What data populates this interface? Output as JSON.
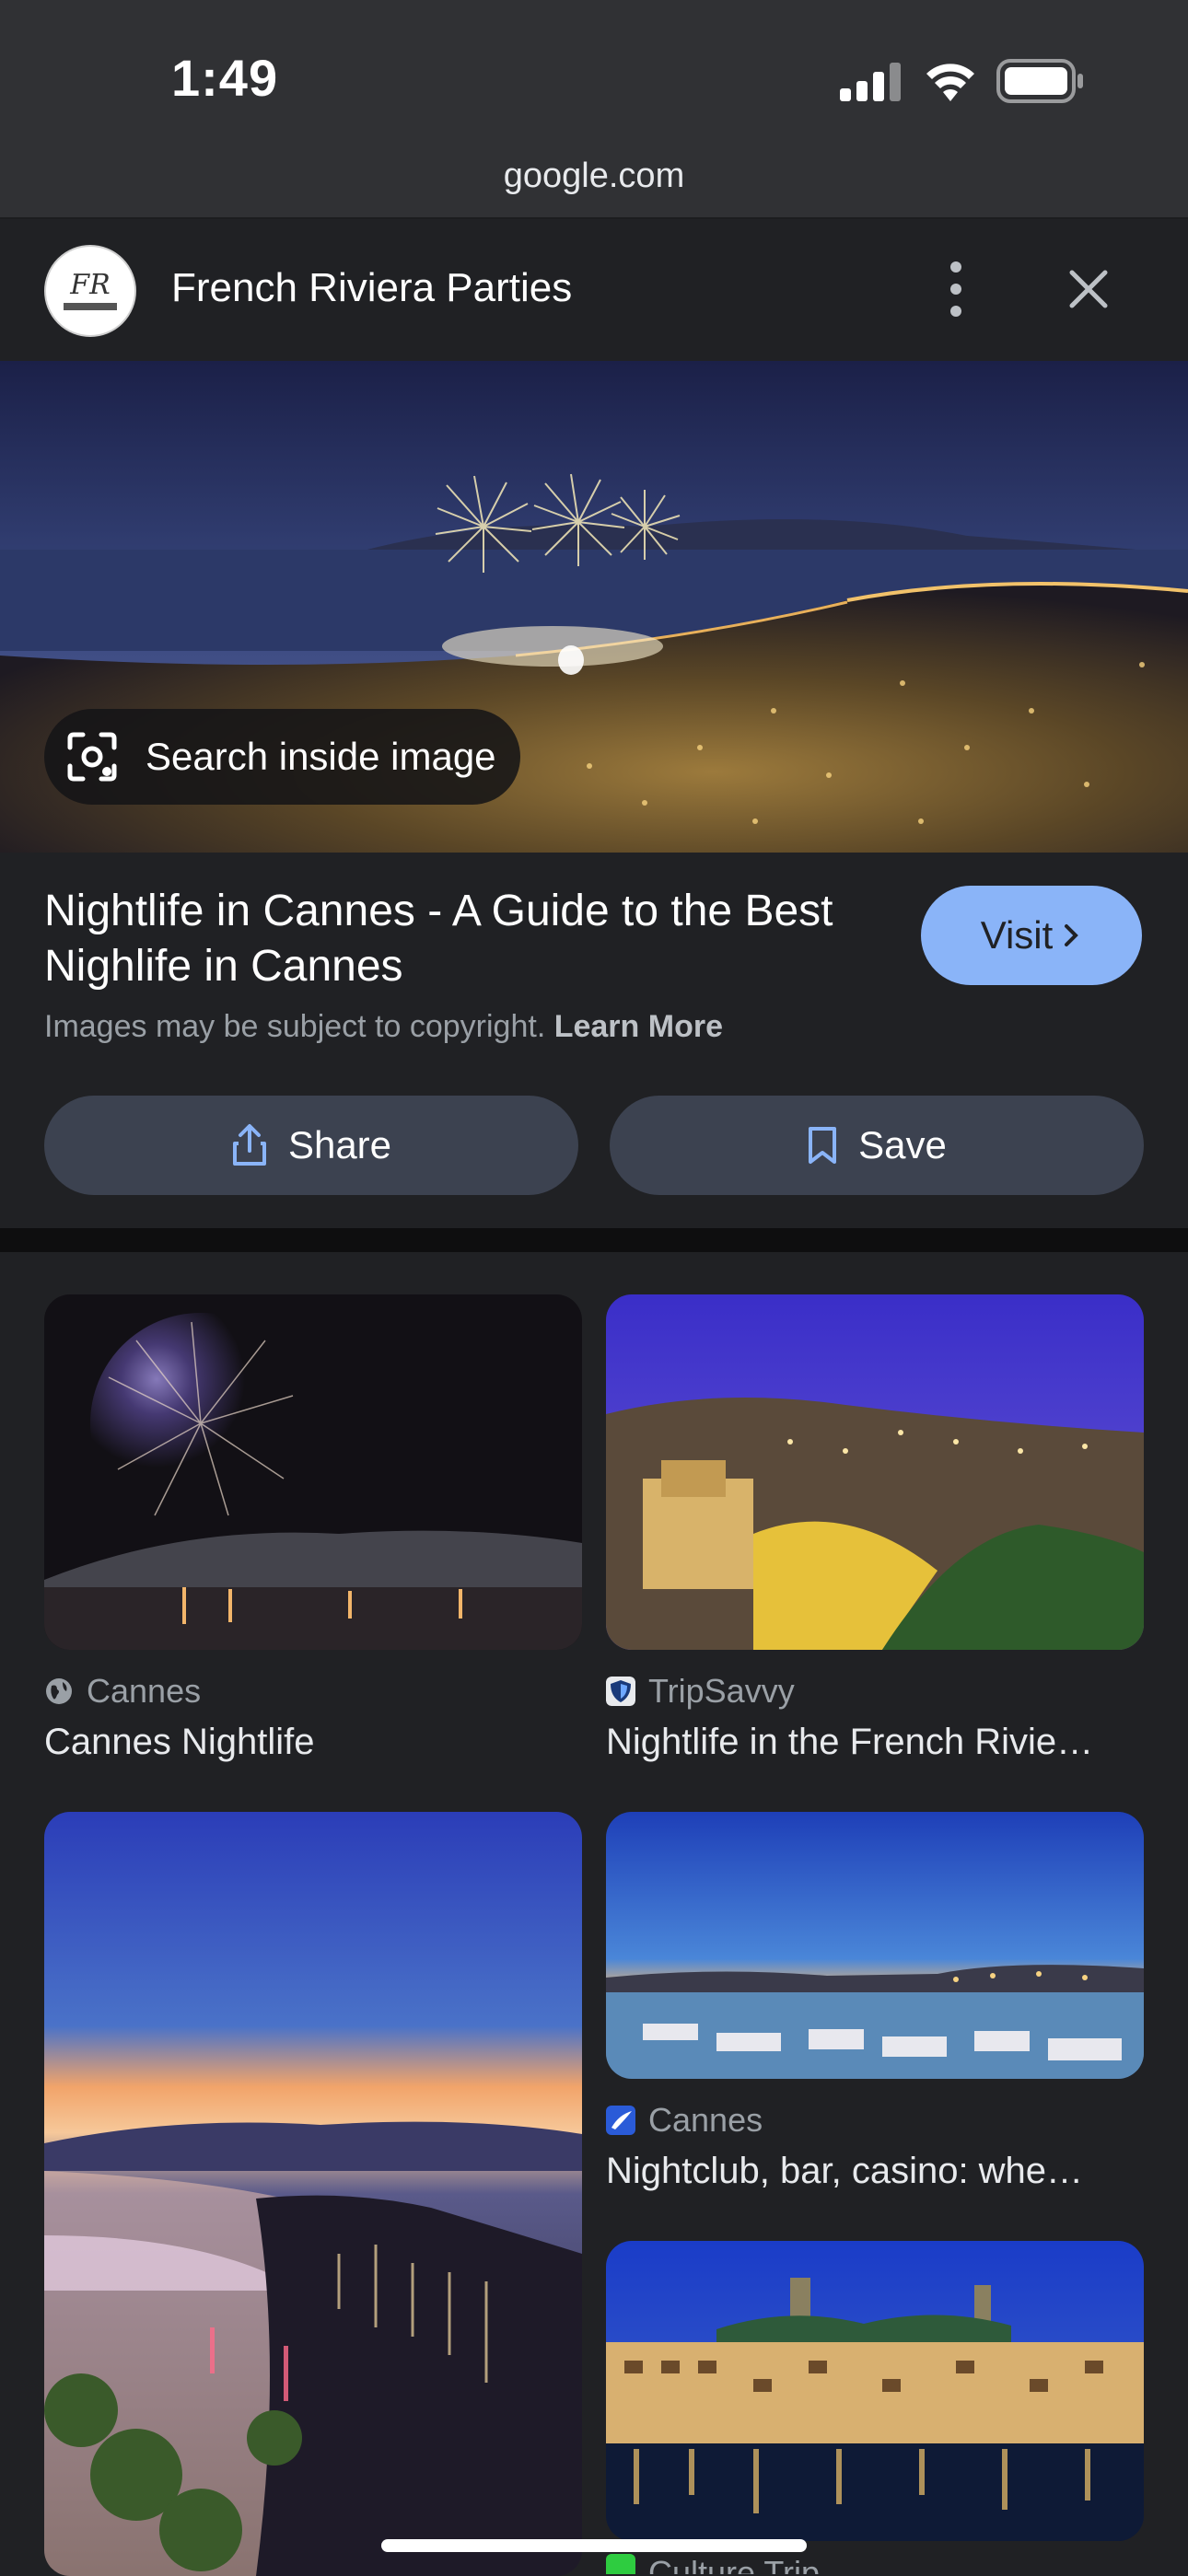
{
  "status_bar": {
    "time": "1:49",
    "url": "google.com"
  },
  "header": {
    "source_title": "French Riviera Parties",
    "avatar_monogram": "FR",
    "avatar_tag": "PARTIES"
  },
  "hero": {
    "search_inside_label": "Search inside image"
  },
  "result": {
    "title": "Nightlife in Cannes - A Guide to the Best Nighlife in Cannes",
    "visit_label": "Visit",
    "copyright_text": "Images may be subject to copyright.",
    "learn_more": "Learn More",
    "share_label": "Share",
    "save_label": "Save"
  },
  "related": [
    {
      "source": "Cannes",
      "icon": "globe-icon",
      "caption": "Cannes Nightlife"
    },
    {
      "source": "TripSavvy",
      "icon": "tripsavvy-shield-icon",
      "caption": "Nightlife in the French Rivie…"
    },
    {
      "source": "",
      "icon": "",
      "caption": ""
    },
    {
      "source": "Cannes",
      "icon": "cannes-logo-icon",
      "caption": "Nightclub, bar, casino: whe…"
    },
    {
      "source": "Culture Trip",
      "icon": "culture-trip-icon",
      "caption": ""
    }
  ],
  "colors": {
    "accent": "#8ab4f8",
    "background": "#202124",
    "pill": "#3c4250"
  }
}
